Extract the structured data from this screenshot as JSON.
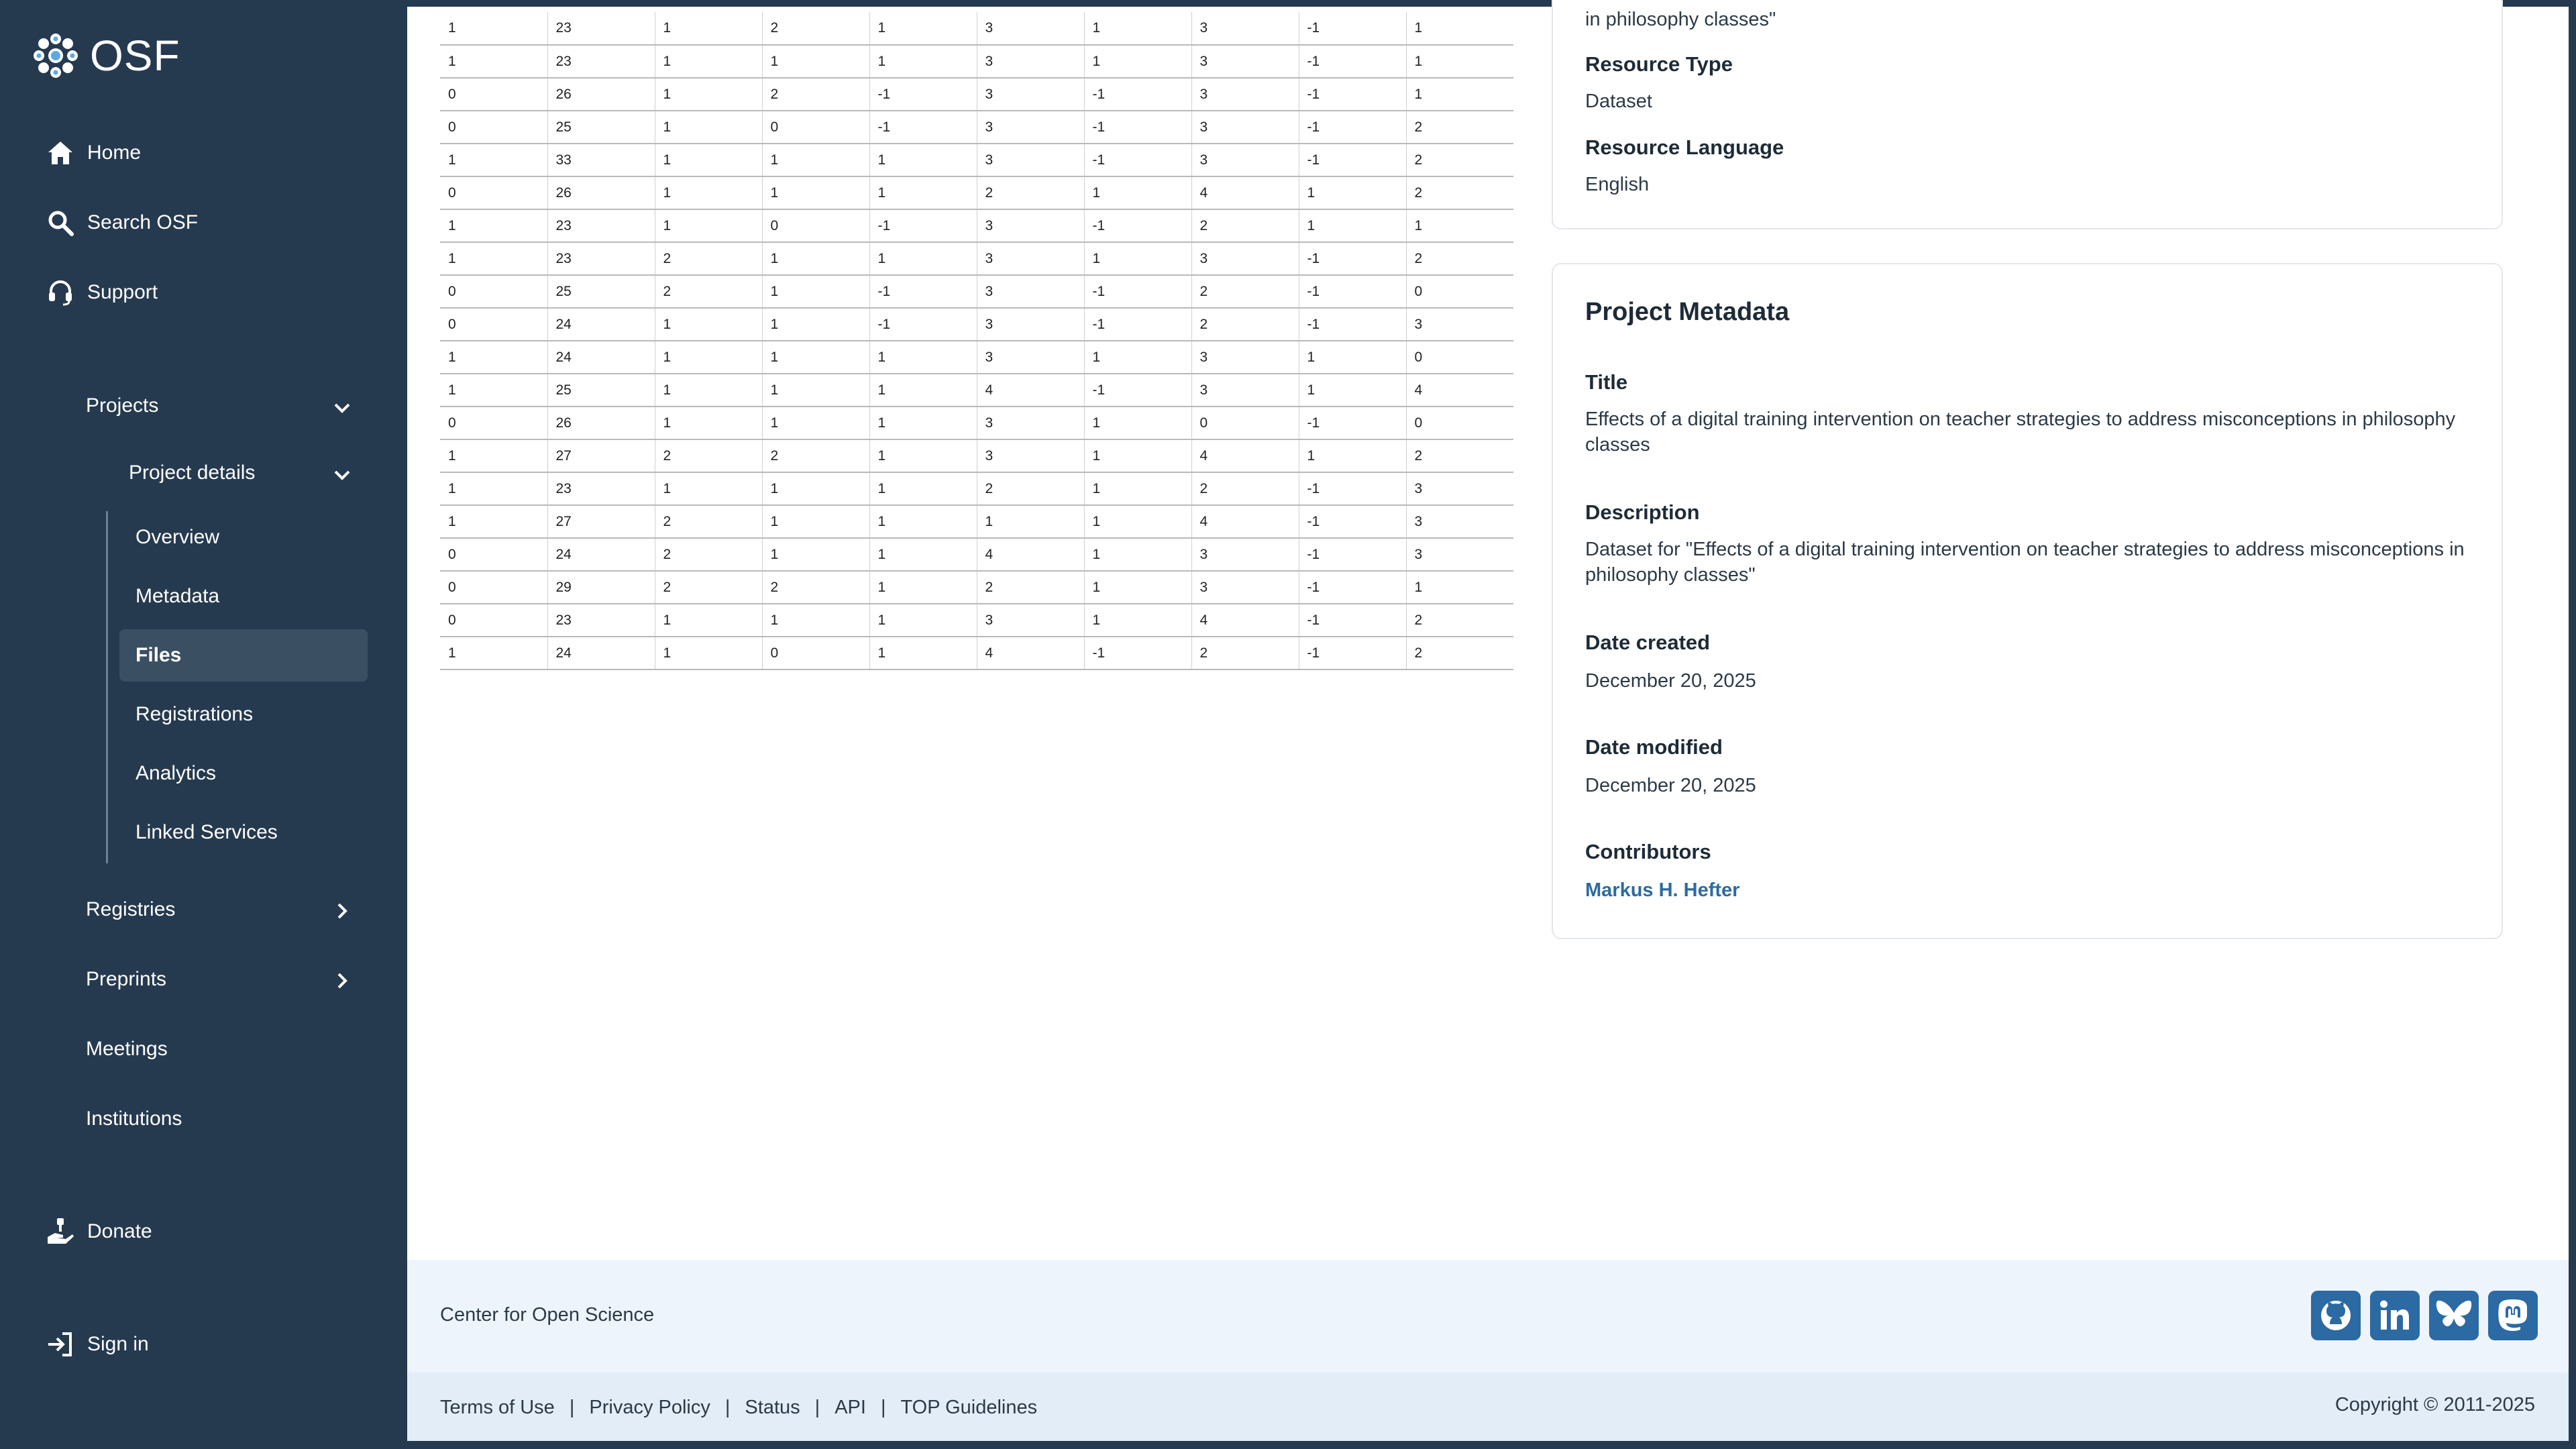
{
  "brand": {
    "name": "OSF"
  },
  "sidebar": {
    "top_items": [
      {
        "label": "Home",
        "icon": "home-icon"
      },
      {
        "label": "Search OSF",
        "icon": "search-icon"
      },
      {
        "label": "Support",
        "icon": "headset-icon"
      }
    ],
    "projects": {
      "label": "Projects",
      "project_details": {
        "label": "Project details",
        "items": [
          "Overview",
          "Metadata",
          "Files",
          "Registrations",
          "Analytics",
          "Linked Services"
        ],
        "active": "Files"
      }
    },
    "other_items": [
      {
        "label": "Registries",
        "expandable": true
      },
      {
        "label": "Preprints",
        "expandable": true
      },
      {
        "label": "Meetings",
        "expandable": false
      },
      {
        "label": "Institutions",
        "expandable": false
      }
    ],
    "donate": {
      "label": "Donate",
      "icon": "donate-icon"
    },
    "sign_in": {
      "label": "Sign in",
      "icon": "sign-in-icon"
    }
  },
  "data_table": {
    "rows": [
      [
        "1",
        "23",
        "1",
        "2",
        "1",
        "3",
        "1",
        "3",
        "-1",
        "1"
      ],
      [
        "1",
        "23",
        "1",
        "1",
        "1",
        "3",
        "1",
        "3",
        "-1",
        "1"
      ],
      [
        "0",
        "26",
        "1",
        "2",
        "-1",
        "3",
        "-1",
        "3",
        "-1",
        "1"
      ],
      [
        "0",
        "25",
        "1",
        "0",
        "-1",
        "3",
        "-1",
        "3",
        "-1",
        "2"
      ],
      [
        "1",
        "33",
        "1",
        "1",
        "1",
        "3",
        "-1",
        "3",
        "-1",
        "2"
      ],
      [
        "0",
        "26",
        "1",
        "1",
        "1",
        "2",
        "1",
        "4",
        "1",
        "2"
      ],
      [
        "1",
        "23",
        "1",
        "0",
        "-1",
        "3",
        "-1",
        "2",
        "1",
        "1"
      ],
      [
        "1",
        "23",
        "2",
        "1",
        "1",
        "3",
        "1",
        "3",
        "-1",
        "2"
      ],
      [
        "0",
        "25",
        "2",
        "1",
        "-1",
        "3",
        "-1",
        "2",
        "-1",
        "0"
      ],
      [
        "0",
        "24",
        "1",
        "1",
        "-1",
        "3",
        "-1",
        "2",
        "-1",
        "3"
      ],
      [
        "1",
        "24",
        "1",
        "1",
        "1",
        "3",
        "1",
        "3",
        "1",
        "0"
      ],
      [
        "1",
        "25",
        "1",
        "1",
        "1",
        "4",
        "-1",
        "3",
        "1",
        "4"
      ],
      [
        "0",
        "26",
        "1",
        "1",
        "1",
        "3",
        "1",
        "0",
        "-1",
        "0"
      ],
      [
        "1",
        "27",
        "2",
        "2",
        "1",
        "3",
        "1",
        "4",
        "1",
        "2"
      ],
      [
        "1",
        "23",
        "1",
        "1",
        "1",
        "2",
        "1",
        "2",
        "-1",
        "3"
      ],
      [
        "1",
        "27",
        "2",
        "1",
        "1",
        "1",
        "1",
        "4",
        "-1",
        "3"
      ],
      [
        "0",
        "24",
        "2",
        "1",
        "1",
        "4",
        "1",
        "3",
        "-1",
        "3"
      ],
      [
        "0",
        "29",
        "2",
        "2",
        "1",
        "2",
        "1",
        "3",
        "-1",
        "1"
      ],
      [
        "0",
        "23",
        "1",
        "1",
        "1",
        "3",
        "1",
        "4",
        "-1",
        "2"
      ],
      [
        "1",
        "24",
        "1",
        "0",
        "1",
        "4",
        "-1",
        "2",
        "-1",
        "2"
      ]
    ]
  },
  "resource_card": {
    "desc_tail": "in philosophy classes\"",
    "resource_type_label": "Resource Type",
    "resource_type_value": "Dataset",
    "resource_language_label": "Resource Language",
    "resource_language_value": "English"
  },
  "project_metadata": {
    "heading": "Project Metadata",
    "title_label": "Title",
    "title_value": "Effects of a digital training intervention on teacher strategies to address misconceptions in philosophy classes",
    "description_label": "Description",
    "description_value": "Dataset for \"Effects of a digital training intervention on teacher strategies to address misconceptions in philosophy classes\"",
    "date_created_label": "Date created",
    "date_created_value": "December 20, 2025",
    "date_modified_label": "Date modified",
    "date_modified_value": "December 20, 2025",
    "contributors_label": "Contributors",
    "contributors": [
      "Markus H. Hefter"
    ]
  },
  "footer": {
    "org": "Center for Open Science",
    "social": [
      "github-icon",
      "linkedin-icon",
      "bluesky-icon",
      "mastodon-icon"
    ],
    "links": [
      "Terms of Use",
      "Privacy Policy",
      "Status",
      "API",
      "TOP Guidelines"
    ],
    "copyright": "Copyright © 2011-2025"
  },
  "colors": {
    "sidebar_bg": "#263a4f",
    "active_item_bg": "#3b4f63",
    "link": "#2d6ba0",
    "social_bg": "#2b6aa3",
    "footer_bg": "#edf4fb"
  }
}
